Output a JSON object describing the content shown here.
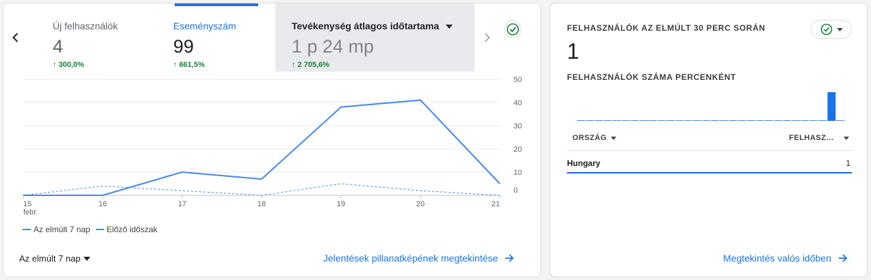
{
  "overview": {
    "metrics": [
      {
        "label": "Új felhasználók",
        "value": "4",
        "delta": "300,0%"
      },
      {
        "label": "Eseményszám",
        "value": "99",
        "delta": "661,5%"
      },
      {
        "label": "Tevékenység átlagos időtartama",
        "value": "1 p 24 mp",
        "delta": "2 705,6%"
      }
    ],
    "legend": {
      "current": "Az elmúlt 7 nap",
      "previous": "Előző időszak"
    },
    "date_range_label": "Az elmúlt 7 nap",
    "view_link": "Jelentések pillanatképének megtekintése"
  },
  "chart_data": {
    "type": "line",
    "x": [
      "15",
      "16",
      "17",
      "18",
      "19",
      "20",
      "21"
    ],
    "x_sublabel_first": "febr.",
    "y_ticks": [
      "50",
      "40",
      "30",
      "20",
      "10",
      "0"
    ],
    "ylim": [
      0,
      50
    ],
    "grid": true,
    "series": [
      {
        "name": "Az elmúlt 7 nap",
        "style": "solid",
        "color": "#4285f4",
        "values": [
          0,
          0,
          10,
          7,
          38,
          41,
          5
        ]
      },
      {
        "name": "Előző időszak",
        "style": "dashed",
        "color": "#4285f4",
        "values": [
          0,
          4,
          2,
          0,
          5,
          2,
          0
        ]
      }
    ]
  },
  "realtime": {
    "title": "FELHASZNÁLÓK AZ ELMÚLT 30 PERC SORÁN",
    "value": "1",
    "per_minute_title": "FELHASZNÁLÓK SZÁMA PERCENKÉNT",
    "per_minute_values": [
      0,
      0,
      0,
      0,
      0,
      0,
      0,
      0,
      0,
      0,
      0,
      0,
      0,
      0,
      0,
      0,
      0,
      0,
      0,
      0,
      0,
      0,
      0,
      0,
      0,
      0,
      0,
      0,
      1,
      0
    ],
    "table": {
      "col_country": "ORSZÁG",
      "col_users": "FELHASZ…",
      "rows": [
        {
          "country": "Hungary",
          "users": "1"
        }
      ]
    },
    "view_link": "Megtekintés valós időben"
  },
  "colors": {
    "accent": "#1a73e8",
    "positive": "#188038",
    "line": "#4285f4"
  }
}
